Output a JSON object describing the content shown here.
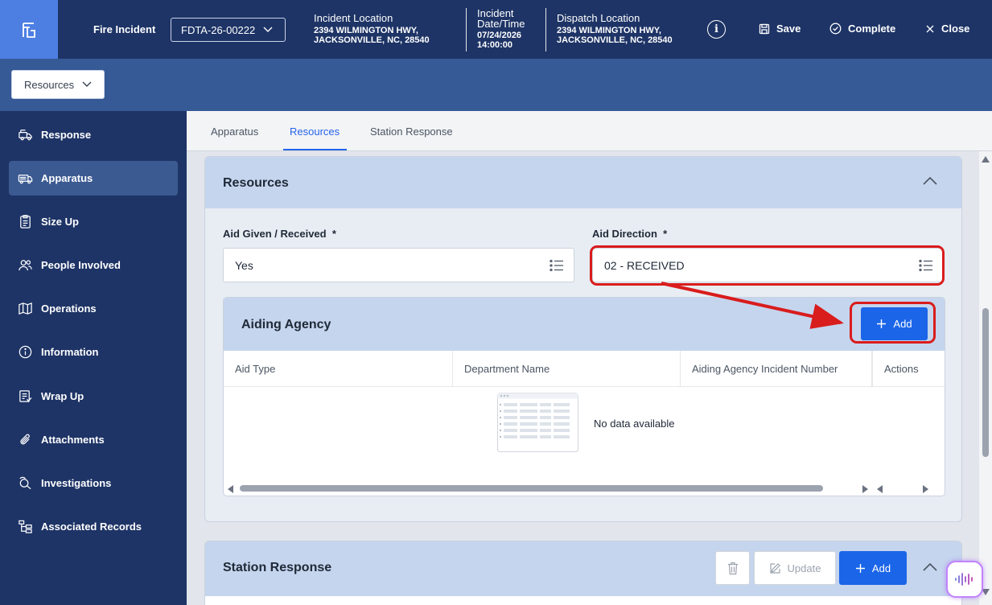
{
  "header": {
    "app_name": "Fire Incident",
    "incident_number": "FDTA-26-00222",
    "incident_location": {
      "label": "Incident Location",
      "line1": "2394 WILMINGTON HWY,",
      "line2": "JACKSONVILLE, NC, 28540"
    },
    "incident_datetime": {
      "label_line1": "Incident",
      "label_line2": "Date/Time",
      "date": "07/24/2026",
      "time": "14:00:00"
    },
    "dispatch_location": {
      "label": "Dispatch Location",
      "line1": "2394 WILMINGTON HWY,",
      "line2": "JACKSONVILLE, NC, 28540"
    },
    "info_glyph": "i",
    "save_label": "Save",
    "complete_label": "Complete",
    "close_label": "Close"
  },
  "subheader": {
    "section_dropdown": "Resources"
  },
  "sidebar": {
    "items": [
      {
        "label": "Response",
        "icon": "fire-truck-icon"
      },
      {
        "label": "Apparatus",
        "icon": "engine-icon",
        "active": true
      },
      {
        "label": "Size Up",
        "icon": "clipboard-icon"
      },
      {
        "label": "People Involved",
        "icon": "people-icon"
      },
      {
        "label": "Operations",
        "icon": "map-icon"
      },
      {
        "label": "Information",
        "icon": "info-icon"
      },
      {
        "label": "Wrap Up",
        "icon": "wrap-up-icon"
      },
      {
        "label": "Attachments",
        "icon": "paperclip-icon"
      },
      {
        "label": "Investigations",
        "icon": "magnifier-icon"
      },
      {
        "label": "Associated Records",
        "icon": "tree-icon"
      }
    ]
  },
  "tabs": [
    {
      "label": "Apparatus"
    },
    {
      "label": "Resources",
      "active": true
    },
    {
      "label": "Station Response"
    }
  ],
  "resources_card": {
    "title": "Resources",
    "aid_given_label": "Aid Given / Received",
    "aid_given_value": "Yes",
    "aid_direction_label": "Aid Direction",
    "aid_direction_value": "02 - RECEIVED",
    "required_mark": "*",
    "aiding_agency": {
      "title": "Aiding Agency",
      "add_label": "Add",
      "columns": [
        "Aid Type",
        "Department Name",
        "Aiding Agency Incident Number",
        "Actions"
      ],
      "empty_message": "No data available"
    }
  },
  "station_response_card": {
    "title": "Station Response",
    "update_label": "Update",
    "add_label": "Add"
  },
  "colors": {
    "header_bg": "#1e3466",
    "subheader_bg": "#365a96",
    "primary": "#1b65e8",
    "annotation": "#d91c1c",
    "card_header": "#c5d5ee"
  }
}
